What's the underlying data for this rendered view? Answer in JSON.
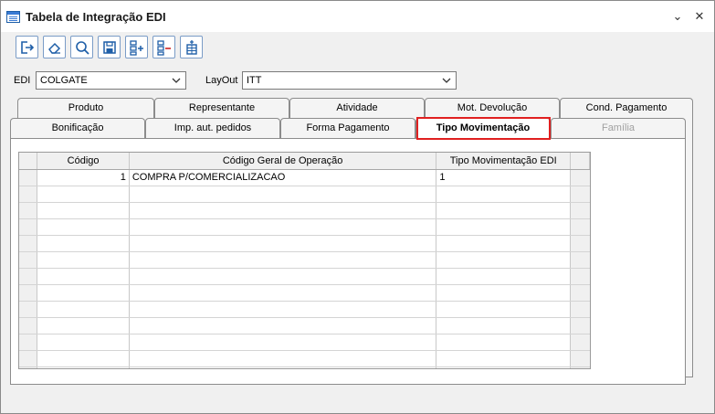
{
  "window": {
    "title": "Tabela de Integração EDI",
    "minimize_glyph": "⌄",
    "close_glyph": "✕"
  },
  "toolbar": {
    "buttons": [
      {
        "name": "exit-icon"
      },
      {
        "name": "eraser-icon"
      },
      {
        "name": "search-icon"
      },
      {
        "name": "save-icon"
      },
      {
        "name": "add-row-icon"
      },
      {
        "name": "remove-row-icon"
      },
      {
        "name": "insert-row-icon"
      }
    ]
  },
  "form": {
    "edi_label": "EDI",
    "edi_value": "COLGATE",
    "layout_label": "LayOut",
    "layout_value": "ITT"
  },
  "tabs": {
    "back_row": [
      "Produto",
      "Representante",
      "Atividade",
      "Mot. Devolução",
      "Cond. Pagamento"
    ],
    "front_row": [
      "Bonificação",
      "Imp. aut. pedidos",
      "Forma Pagamento",
      "Tipo Movimentação",
      "Família"
    ],
    "active": "Tipo Movimentação",
    "disabled": "Família"
  },
  "grid": {
    "columns": [
      "Código",
      "Código Geral de Operação",
      "Tipo Movimentação EDI"
    ],
    "rows": [
      [
        "1",
        "COMPRA P/COMERCIALIZACAO",
        "1"
      ]
    ]
  },
  "colors": {
    "highlight_border": "#e02020",
    "icon_blue": "#1f5fa8"
  }
}
